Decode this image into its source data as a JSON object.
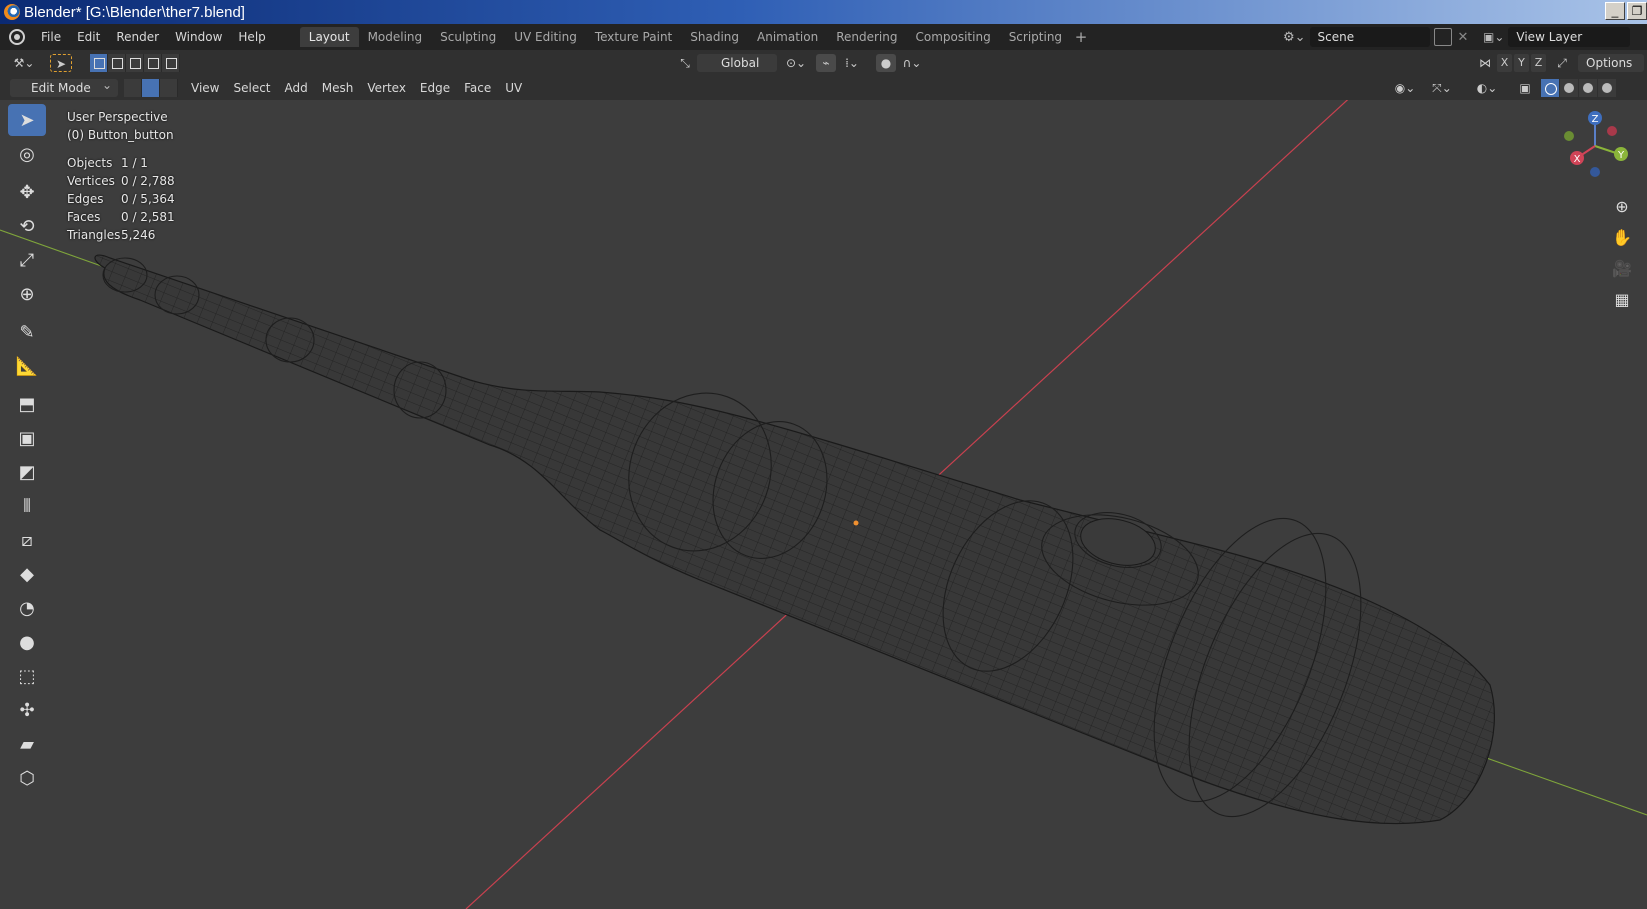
{
  "window": {
    "title": "Blender* [G:\\Blender\\ther7.blend]",
    "buttons": [
      "_",
      "❐"
    ]
  },
  "menu": {
    "items": [
      "File",
      "Edit",
      "Render",
      "Window",
      "Help"
    ]
  },
  "workspaces": {
    "tabs": [
      "Layout",
      "Modeling",
      "Sculpting",
      "UV Editing",
      "Texture Paint",
      "Shading",
      "Animation",
      "Rendering",
      "Compositing",
      "Scripting"
    ],
    "active": "Layout",
    "add": "+"
  },
  "scene": {
    "name": "Scene",
    "close": "✕"
  },
  "view_layer": {
    "name": "View Layer"
  },
  "tool_settings": {
    "transform_orientation": "Global",
    "axis_x": "X",
    "axis_y": "Y",
    "axis_z": "Z",
    "options_label": "Options"
  },
  "viewport_header": {
    "mode": "Edit Mode",
    "menus": [
      "View",
      "Select",
      "Add",
      "Mesh",
      "Vertex",
      "Edge",
      "Face",
      "UV"
    ]
  },
  "overlay": {
    "view_name": "User Perspective",
    "object_name": "(0) Button_button",
    "stats": [
      {
        "label": "Objects",
        "value": "1 / 1"
      },
      {
        "label": "Vertices",
        "value": "0 / 2,788"
      },
      {
        "label": "Edges",
        "value": "0 / 5,364"
      },
      {
        "label": "Faces",
        "value": "0 / 2,581"
      },
      {
        "label": "Triangles",
        "value": "5,246"
      }
    ]
  },
  "gizmo": {
    "x": "X",
    "y": "Y",
    "z": "Z"
  },
  "tools": [
    "select-box-icon",
    "cursor-icon",
    "move-icon",
    "rotate-icon",
    "scale-icon",
    "transform-icon",
    "annotate-icon",
    "measure-icon",
    "extrude-icon",
    "inset-icon",
    "bevel-icon",
    "loop-cut-icon",
    "knife-icon",
    "poly-build-icon",
    "spin-icon",
    "smooth-icon",
    "edge-slide-icon",
    "shrink-fatten-icon",
    "shear-icon",
    "rip-icon"
  ],
  "colors": {
    "viewport_bg": "#3d3d3d",
    "x_axis": "#c8414f",
    "y_axis": "#7fa53b",
    "accent": "#4772b3"
  }
}
